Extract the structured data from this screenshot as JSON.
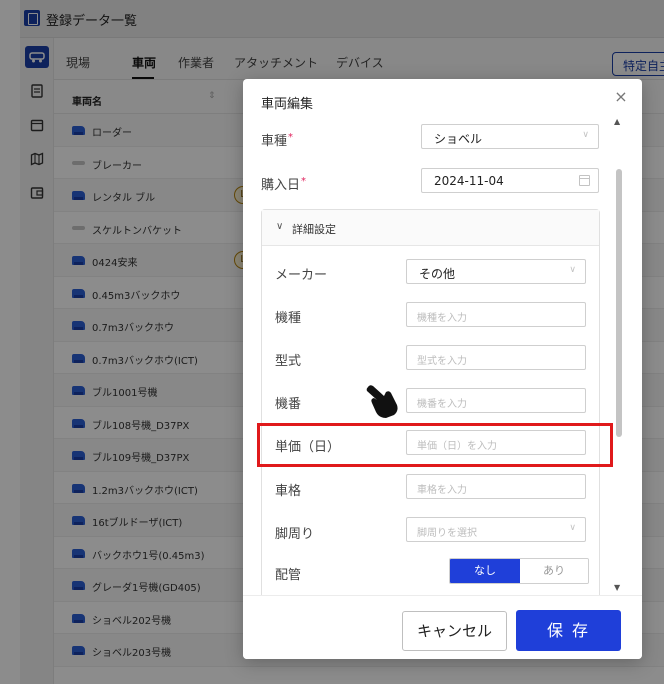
{
  "window": {
    "title": "登録データ一覧"
  },
  "nav": {
    "tabs": [
      "現場",
      "車両",
      "作業者",
      "アタッチメント",
      "デバイス"
    ],
    "active_tab": "車両",
    "right_button": "特定自主検"
  },
  "table": {
    "header": "車両名",
    "rows": [
      {
        "name": "ローダー",
        "icon": "loader-icon",
        "badge": ""
      },
      {
        "name": "ブレーカー",
        "icon": "breaker-icon",
        "badge": ""
      },
      {
        "name": "レンタル ブル",
        "icon": "bulldozer-icon",
        "badge": "L"
      },
      {
        "name": "スケルトンバケット",
        "icon": "bucket-icon",
        "badge": ""
      },
      {
        "name": "0424安来",
        "icon": "excavator-icon",
        "badge": "L"
      },
      {
        "name": "0.45m3バックホウ",
        "icon": "excavator-icon",
        "badge": ""
      },
      {
        "name": "0.7m3バックホウ",
        "icon": "excavator-icon",
        "badge": ""
      },
      {
        "name": "0.7m3バックホウ(ICT)",
        "icon": "excavator-icon",
        "badge": ""
      },
      {
        "name": "ブル1001号機",
        "icon": "bulldozer-icon",
        "badge": ""
      },
      {
        "name": "ブル108号機_D37PX",
        "icon": "bulldozer-icon",
        "badge": ""
      },
      {
        "name": "ブル109号機_D37PX",
        "icon": "bulldozer-icon",
        "badge": ""
      },
      {
        "name": "1.2m3バックホウ(ICT)",
        "icon": "excavator-icon",
        "badge": ""
      },
      {
        "name": "16tブルドーザ(ICT)",
        "icon": "bulldozer-icon",
        "badge": ""
      },
      {
        "name": "バックホウ1号(0.45m3)",
        "icon": "excavator-icon",
        "badge": ""
      },
      {
        "name": "グレーダ1号機(GD405)",
        "icon": "grader-icon",
        "badge": ""
      },
      {
        "name": "ショベル202号機",
        "icon": "excavator-icon",
        "badge": ""
      },
      {
        "name": "ショベル203号機",
        "icon": "excavator-icon",
        "badge": ""
      }
    ]
  },
  "modal": {
    "title": "車両編集",
    "fields": {
      "vehicle_type": {
        "label": "車種",
        "value": "ショベル"
      },
      "purchase_date": {
        "label": "購入日",
        "value": "2024-11-04"
      },
      "section_title": "詳細設定",
      "maker": {
        "label": "メーカー",
        "value": "その他"
      },
      "model": {
        "label": "機種",
        "placeholder": "機種を入力"
      },
      "type": {
        "label": "型式",
        "placeholder": "型式を入力"
      },
      "serial": {
        "label": "機番",
        "placeholder": "機番を入力"
      },
      "unit_price": {
        "label": "単価（日）",
        "placeholder": "単価（日）を入力"
      },
      "class": {
        "label": "車格",
        "placeholder": "車格を入力"
      },
      "undercarriage": {
        "label": "脚周り",
        "placeholder": "脚周りを選択"
      },
      "piping": {
        "label": "配管",
        "on": "なし",
        "off": "あり"
      }
    },
    "cancel": "キャンセル",
    "save": "保 存"
  },
  "colors": {
    "primary": "#1f3fd9",
    "highlight": "#e0191b",
    "badge": "#b8860b"
  }
}
